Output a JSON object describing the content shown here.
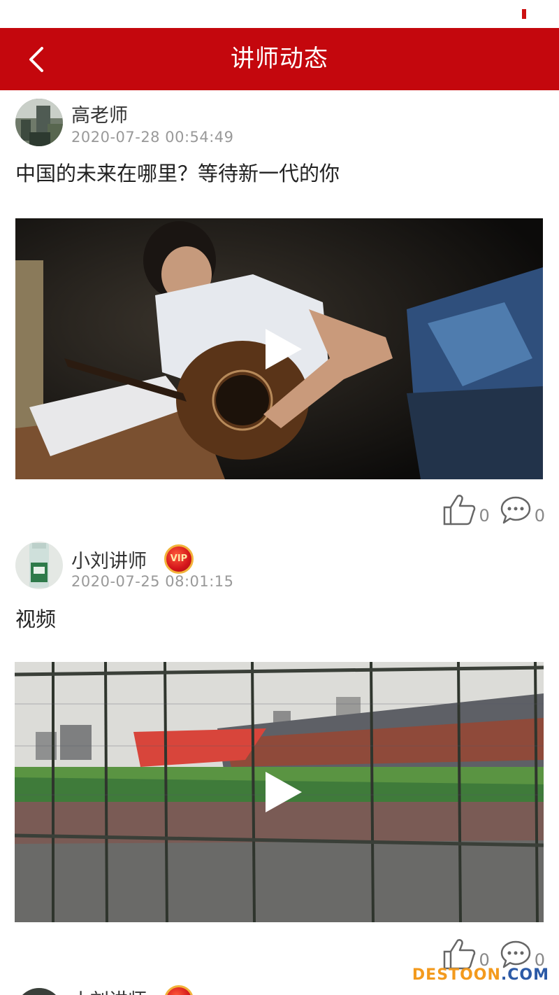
{
  "header": {
    "title": "讲师动态",
    "back_icon": "chevron-left-icon",
    "bg_color": "#c4070d"
  },
  "posts": [
    {
      "author": "高老师",
      "time": "2020-07-28 00:54:49",
      "text": "中国的未来在哪里？等待新一代的你",
      "vip": false,
      "likes": "0",
      "comments": "0"
    },
    {
      "author": "小刘讲师",
      "time": "2020-07-25 08:01:15",
      "text": "视频",
      "vip": true,
      "vip_label": "VIP",
      "likes": "0",
      "comments": "0"
    },
    {
      "author": "小刘讲师",
      "vip": true
    }
  ],
  "watermark": {
    "part1": "DESTOON",
    "part2": ".COM"
  }
}
